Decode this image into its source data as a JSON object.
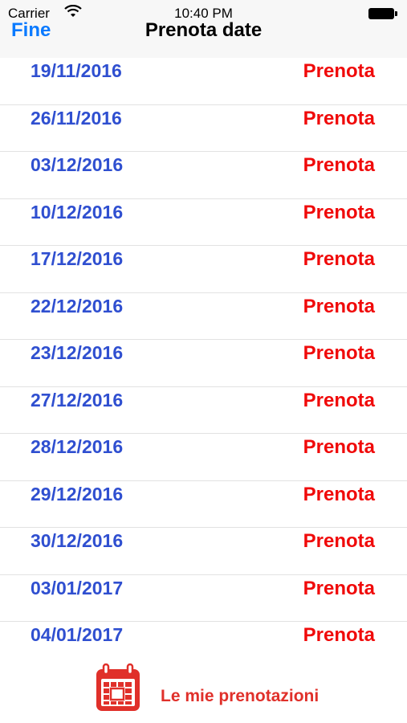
{
  "status_bar": {
    "carrier": "Carrier",
    "time": "10:40 PM"
  },
  "nav": {
    "back_label": "Fine",
    "title": "Prenota date"
  },
  "bookings": [
    {
      "date": "19/11/2016",
      "action": "Prenota"
    },
    {
      "date": "26/11/2016",
      "action": "Prenota"
    },
    {
      "date": "03/12/2016",
      "action": "Prenota"
    },
    {
      "date": "10/12/2016",
      "action": "Prenota"
    },
    {
      "date": "17/12/2016",
      "action": "Prenota"
    },
    {
      "date": "22/12/2016",
      "action": "Prenota"
    },
    {
      "date": "23/12/2016",
      "action": "Prenota"
    },
    {
      "date": "27/12/2016",
      "action": "Prenota"
    },
    {
      "date": "28/12/2016",
      "action": "Prenota"
    },
    {
      "date": "29/12/2016",
      "action": "Prenota"
    },
    {
      "date": "30/12/2016",
      "action": "Prenota"
    },
    {
      "date": "03/01/2017",
      "action": "Prenota"
    },
    {
      "date": "04/01/2017",
      "action": "Prenota"
    }
  ],
  "footer": {
    "label": "Le mie prenotazioni",
    "icon": "calendar-icon"
  },
  "colors": {
    "date_text": "#2f4fd0",
    "action_text": "#f00a0a",
    "nav_link": "#0a7aff",
    "footer_accent": "#e0302a"
  }
}
